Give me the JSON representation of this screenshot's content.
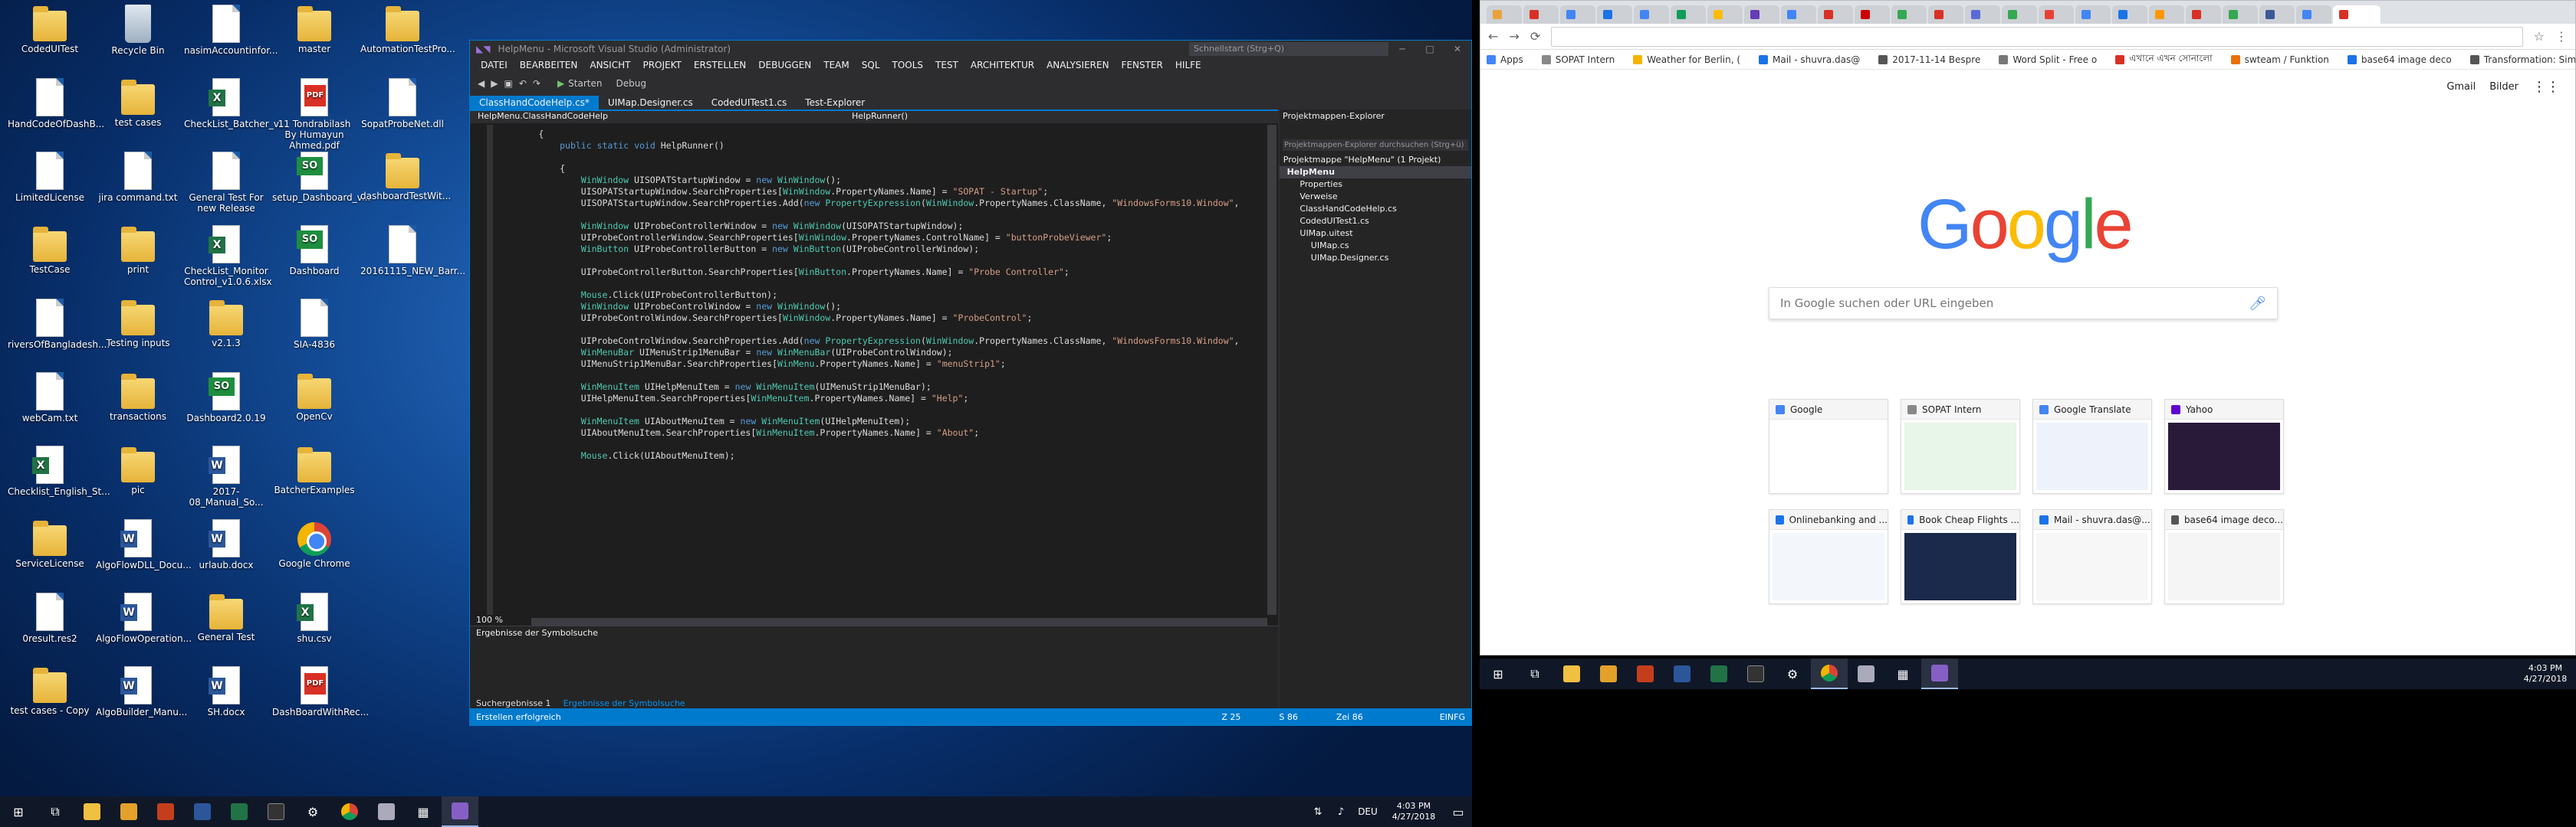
{
  "desktop": {
    "icons": [
      {
        "label": "CodedUITest",
        "icon": "folder-icon"
      },
      {
        "label": "HandCodeOfDashB...",
        "icon": "file-icon"
      },
      {
        "label": "LimitedLicense",
        "icon": "file-icon"
      },
      {
        "label": "TestCase",
        "icon": "folder-icon"
      },
      {
        "label": "riversOfBangladesh....",
        "icon": "file-icon"
      },
      {
        "label": "webCam.txt",
        "icon": "file-icon"
      },
      {
        "label": "Checklist_English_St...",
        "icon": "excel-icon"
      },
      {
        "label": "ServiceLicense",
        "icon": "folder-icon"
      },
      {
        "label": "0result.res2",
        "icon": "file-icon"
      },
      {
        "label": "test cases - Copy",
        "icon": "folder-icon"
      },
      {
        "label": "Recycle Bin",
        "icon": "recycle-bin-icon"
      },
      {
        "label": "test cases",
        "icon": "folder-icon"
      },
      {
        "label": "jira command.txt",
        "icon": "file-icon"
      },
      {
        "label": "print",
        "icon": "folder-icon"
      },
      {
        "label": "Testing inputs",
        "icon": "folder-icon"
      },
      {
        "label": "transactions",
        "icon": "folder-icon"
      },
      {
        "label": "pic",
        "icon": "folder-icon"
      },
      {
        "label": "AlgoFlowDLL_Docu...",
        "icon": "word-icon"
      },
      {
        "label": "AlgoFlowOperation...",
        "icon": "word-icon"
      },
      {
        "label": "AlgoBuilder_Manu...",
        "icon": "word-icon"
      },
      {
        "label": "nasimAccountinfor...",
        "icon": "file-icon"
      },
      {
        "label": "CheckList_Batcher_v...",
        "icon": "excel-icon"
      },
      {
        "label": "General Test For new Release",
        "icon": "file-icon"
      },
      {
        "label": "CheckList_Monitor Control_v1.0.6.xlsx",
        "icon": "excel-icon"
      },
      {
        "label": "v2.1.3",
        "icon": "folder-icon"
      },
      {
        "label": "Dashboard2.0.19",
        "icon": "so-icon"
      },
      {
        "label": "2017-08_Manual_So...",
        "icon": "word-icon"
      },
      {
        "label": "urlaub.docx",
        "icon": "word-icon"
      },
      {
        "label": "General Test",
        "icon": "folder-icon"
      },
      {
        "label": "SH.docx",
        "icon": "word-icon"
      },
      {
        "label": "master",
        "icon": "folder-icon"
      },
      {
        "label": "11 Tondrabilash By Humayun Ahmed.pdf",
        "icon": "pdf-icon"
      },
      {
        "label": "setup_Dashboard_v...",
        "icon": "so-icon"
      },
      {
        "label": "Dashboard",
        "icon": "so-icon"
      },
      {
        "label": "SIA-4836",
        "icon": "file-icon"
      },
      {
        "label": "OpenCv",
        "icon": "folder-icon"
      },
      {
        "label": "BatcherExamples",
        "icon": "folder-icon"
      },
      {
        "label": "Google Chrome",
        "icon": "chrome-icon"
      },
      {
        "label": "shu.csv",
        "icon": "excel-icon"
      },
      {
        "label": "DashBoardWithRec...",
        "icon": "pdf-icon"
      },
      {
        "label": "AutomationTestPro...",
        "icon": "folder-icon"
      },
      {
        "label": "SopatProbeNet.dll",
        "icon": "file-icon"
      },
      {
        "label": "dashboardTestWit...",
        "icon": "folder-icon"
      },
      {
        "label": "20161115_NEW_Barr...",
        "icon": "file-icon"
      }
    ]
  },
  "vs": {
    "title": "HelpMenu - Microsoft Visual Studio (Administrator)",
    "quicklaunch": "Schnellstart (Strg+Q)",
    "menu": [
      "DATEI",
      "BEARBEITEN",
      "ANSICHT",
      "PROJEKT",
      "ERSTELLEN",
      "DEBUGGEN",
      "TEAM",
      "SQL",
      "TOOLS",
      "TEST",
      "ARCHITEKTUR",
      "ANALYSIEREN",
      "FENSTER",
      "HILFE"
    ],
    "start": "Starten",
    "config": "Debug",
    "tabs": [
      "ClassHandCodeHelp.cs*",
      "UIMap.Designer.cs",
      "CodedUITest1.cs",
      "Test-Explorer"
    ],
    "nav_left": "HelpMenu.ClassHandCodeHelp",
    "nav_right": "HelpRunner()",
    "zoom": "100 %",
    "code": [
      {
        "t": "        {"
      },
      {
        "t": "            public static void HelpRunner()"
      },
      {
        "t": "            {"
      },
      {
        "t": "                WinWindow UISOPATStartupWindow = new WinWindow();"
      },
      {
        "t": "                UISOPATStartupWindow.SearchProperties[WinWindow.PropertyNames.Name] = \"SOPAT - Startup\";"
      },
      {
        "t": "                UISOPATStartupWindow.SearchProperties.Add(new PropertyExpression(WinWindow.PropertyNames.ClassName, \"WindowsForms10.Window\","
      },
      {
        "t": "                WinWindow UIProbeControllerWindow = new WinWindow(UISOPATStartupWindow);"
      },
      {
        "t": "                UIProbeControllerWindow.SearchProperties[WinWindow.PropertyNames.ControlName] = \"buttonProbeViewer\";"
      },
      {
        "t": "                WinButton UIProbeControllerButton = new WinButton(UIProbeControllerWindow);"
      },
      {
        "t": "                UIProbeControllerButton.SearchProperties[WinButton.PropertyNames.Name] = \"Probe Controller\";"
      },
      {
        "t": "                Mouse.Click(UIProbeControllerButton);"
      },
      {
        "t": "                WinWindow UIProbeControlWindow = new WinWindow();"
      },
      {
        "t": "                UIProbeControlWindow.SearchProperties[WinWindow.PropertyNames.Name] = \"ProbeControl\";"
      },
      {
        "t": "                UIProbeControlWindow.SearchProperties.Add(new PropertyExpression(WinWindow.PropertyNames.ClassName, \"WindowsForms10.Window\","
      },
      {
        "t": "                WinMenuBar UIMenuStrip1MenuBar = new WinMenuBar(UIProbeControlWindow);"
      },
      {
        "t": "                UIMenuStrip1MenuBar.SearchProperties[WinMenu.PropertyNames.Name] = \"menuStrip1\";"
      },
      {
        "t": "                WinMenuItem UIHelpMenuItem = new WinMenuItem(UIMenuStrip1MenuBar);"
      },
      {
        "t": "                UIHelpMenuItem.SearchProperties[WinMenuItem.PropertyNames.Name] = \"Help\";"
      },
      {
        "t": "                WinMenuItem UIAboutMenuItem = new WinMenuItem(UIHelpMenuItem);"
      },
      {
        "t": "                UIAboutMenuItem.SearchProperties[WinMenuItem.PropertyNames.Name] = \"About\";"
      },
      {
        "t": "                Mouse.Click(UIAboutMenuItem);"
      }
    ],
    "solution": {
      "title": "Projektmappen-Explorer",
      "search": "Projektmappen-Explorer durchsuchen (Strg+ü)",
      "items": [
        "Projektmappe \"HelpMenu\" (1 Projekt)",
        "HelpMenu",
        "Properties",
        "Verweise",
        "ClassHandCodeHelp.cs",
        "CodedUITest1.cs",
        "UIMap.uitest",
        "UIMap.cs",
        "UIMap.Designer.cs"
      ]
    },
    "bottom_title": "Ergebnisse der Symbolsuche",
    "bottom_tabs": [
      "Suchergebnisse 1",
      "Ergebnisse der Symbolsuche"
    ],
    "status": {
      "left": "Erstellen erfolgreich",
      "col": "Z 25",
      "ch": "S 86",
      "zei": "Zei 86",
      "mode": "EINFG"
    }
  },
  "browser": {
    "bookmarks": [
      "Apps",
      "SOPAT Intern",
      "Weather for Berlin, (",
      "Mail - shuvra.das@",
      "2017-11-14 Bespre",
      "Word Split - Free o",
      "এখানে এখন সোনালো",
      "swteam / Funktion",
      "base64 image deco",
      "Transformation: Sim"
    ],
    "top_links": [
      "Gmail",
      "Bilder"
    ],
    "search_placeholder": "In Google suchen oder URL eingeben",
    "logo": "Google",
    "tiles": [
      "Google",
      "SOPAT Intern",
      "Google Translate",
      "Yahoo",
      "Onlinebanking and ...",
      "Book Cheap Flights ...",
      "Mail - shuvra.das@...",
      "base64 image deco..."
    ]
  },
  "clock": {
    "time": "4:03 PM",
    "date": "4/27/2018"
  },
  "tray_lang": "DEU"
}
